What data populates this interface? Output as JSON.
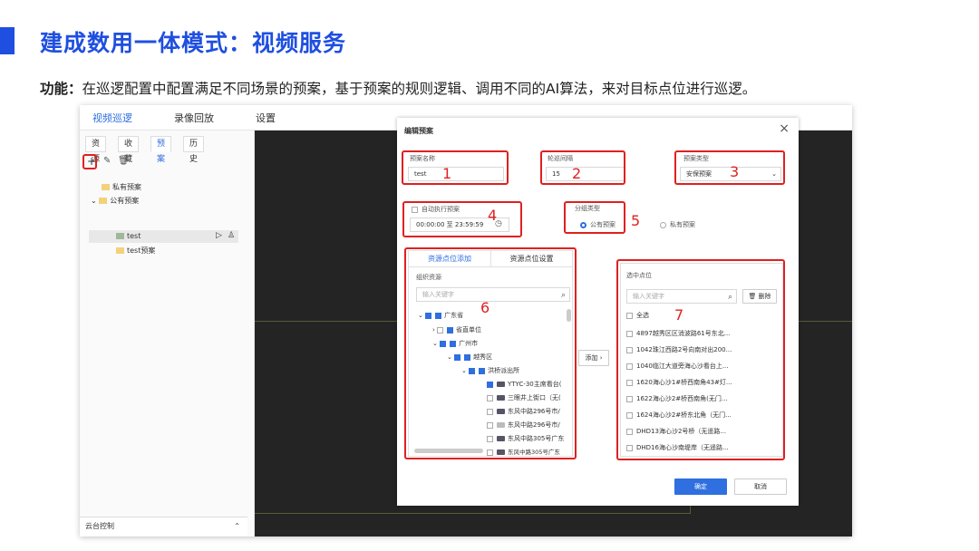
{
  "slide": {
    "title": "建成数用一体模式：视频服务",
    "desc_label": "功能",
    "desc_text": "在巡逻配置中配置满足不同场景的预案，基于预案的规则逻辑、调用不同的AI算法，来对目标点位进行巡逻。"
  },
  "topnav": [
    "视频巡逻",
    "录像回放",
    "设置"
  ],
  "left": {
    "tabs": [
      "资源",
      "收藏",
      "预案",
      "历史"
    ],
    "tree": {
      "private": "私有预案",
      "public": "公有预案",
      "plan1": "test",
      "plan2": "test预案"
    },
    "ptz": "云台控制"
  },
  "dialog": {
    "title": "编辑预案",
    "name_label": "预案名称",
    "name_value": "test",
    "interval_label": "轮巡间隔",
    "interval_value": "15",
    "type_label": "预案类型",
    "type_value": "安保预案",
    "auto_label": "自动执行预案",
    "time_value": "00:00:00 至 23:59:59",
    "group_label": "分组类型",
    "group_public": "公有预案",
    "group_private": "私有预案",
    "tab_add": "资源点位添加",
    "tab_settings": "资源点位设置",
    "org_label": "组织资源",
    "search_placeholder": "输入关键字",
    "tree": [
      "广东省",
      "省直单位",
      "广州市",
      "越秀区",
      "洪桥派出所",
      "YTYC-30主席看台(",
      "三眼井上街口（无(",
      "东风中路296号市/",
      "东风中路296号市/",
      "东风中路305号广东",
      "东风中路305号广东"
    ],
    "add_btn": "添加",
    "selected_label": "选中点位",
    "delete_btn": "删除",
    "select_all": "全选",
    "selected": [
      "4897越秀区区消波路61号东北...",
      "1042珠江西路2号向南对出200...",
      "1040临江大道旁海心沙看台上...",
      "1620海心沙1#桥西南角43#灯...",
      "1622海心沙2#桥西南角(无门...",
      "1624海心沙2#桥东北角（无门...",
      "DHD13海心沙2号桥（无遥路...",
      "DHD16海心沙南堤岸（无遥路..."
    ],
    "ok": "确定",
    "cancel": "取消"
  },
  "annotations": [
    "1",
    "2",
    "3",
    "4",
    "5",
    "6",
    "7"
  ],
  "colors": {
    "accent": "#1f4fe0",
    "ui_blue": "#2f6fdf",
    "annotation": "#e02020",
    "video_bg": "#242424"
  }
}
